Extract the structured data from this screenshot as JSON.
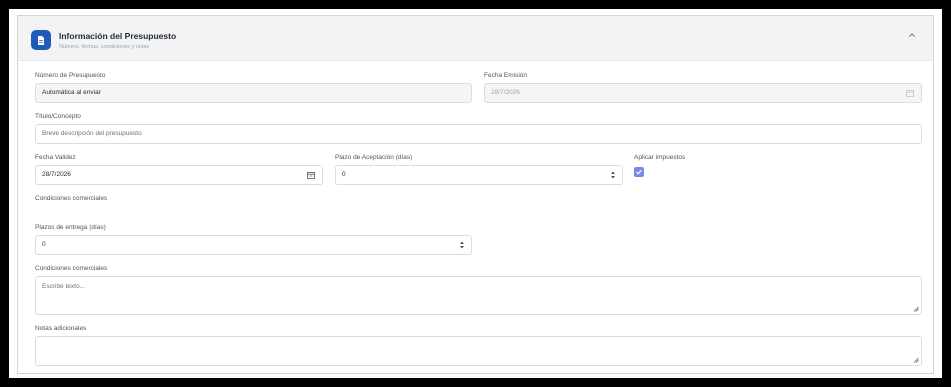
{
  "section": {
    "title": "Información del Presupuesto",
    "subtitle": "Número, fechas, condiciones y notas",
    "icon": "document-icon",
    "accent": "#1e5bb8"
  },
  "fields": {
    "numero": {
      "label": "Número de Presupuesto",
      "value": "Automática al enviar"
    },
    "emision": {
      "label": "Fecha Emisión",
      "value": "28/7/2026"
    },
    "titulo": {
      "label": "Título/Concepto",
      "placeholder": "Breve descripción del presupuesto"
    },
    "validez": {
      "label": "Fecha Validez",
      "value": "28/7/2026"
    },
    "plazo_aceptacion": {
      "label": "Plazo de Aceptación (días)",
      "value": "0"
    },
    "impuestos": {
      "label": "Aplicar impuestos",
      "checked": true
    },
    "condiciones_heading": {
      "label": "Condiciones comerciales"
    },
    "plazo_entrega": {
      "label": "Plazos de entrega (días)",
      "value": "0"
    },
    "condiciones": {
      "label": "Condiciones comerciales",
      "placeholder": "Escribe texto..."
    },
    "notas": {
      "label": "Notas adicionales",
      "placeholder": ""
    }
  }
}
